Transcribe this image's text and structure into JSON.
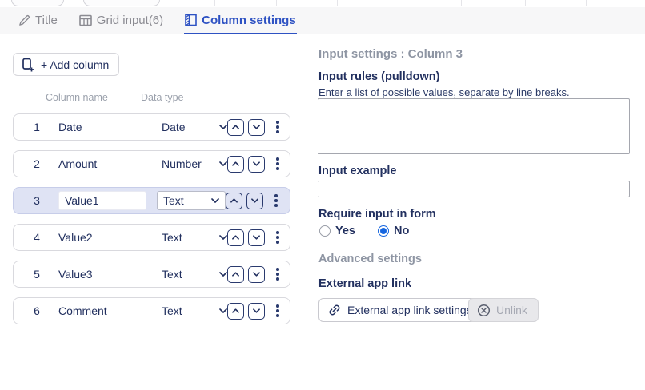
{
  "tabs": [
    {
      "label": "Title",
      "active": false
    },
    {
      "label": "Grid input(6)",
      "active": false
    },
    {
      "label": "Column settings",
      "active": true
    }
  ],
  "left_panel": {
    "add_column_button": "+ Add column",
    "headers": {
      "column_name": "Column name",
      "data_type": "Data type"
    },
    "rows": [
      {
        "num": "1",
        "name": "Date",
        "type": "Date"
      },
      {
        "num": "2",
        "name": "Amount",
        "type": "Number"
      },
      {
        "num": "3",
        "name": "Value1",
        "type": "Text"
      },
      {
        "num": "4",
        "name": "Value2",
        "type": "Text"
      },
      {
        "num": "5",
        "name": "Value3",
        "type": "Text"
      },
      {
        "num": "6",
        "name": "Comment",
        "type": "Text"
      }
    ],
    "selected_row_number": "3"
  },
  "right_panel": {
    "heading": "Input settings : Column 3",
    "input_rules": {
      "label": "Input rules (pulldown)",
      "help": "Enter a list of possible values, separate by line breaks.",
      "value": ""
    },
    "input_example": {
      "label": "Input example",
      "value": ""
    },
    "require_input": {
      "label": "Require input in form",
      "options": [
        {
          "label": "Yes",
          "selected": false
        },
        {
          "label": "No",
          "selected": true
        }
      ]
    },
    "advanced_heading": "Advanced settings",
    "external_app_link": {
      "label": "External app link",
      "settings_button": "External app link settings",
      "unlink_button": "Unlink",
      "unlink_disabled": true
    }
  },
  "icons": {
    "tab_title": "pencil-icon",
    "tab_grid_input": "grid-icon",
    "tab_column_settings": "column-settings-icon",
    "add_column": "add-column-plus-icon",
    "type_dropdown": "chevron-down-icon",
    "move_up": "chevron-up-icon",
    "move_down": "chevron-down-icon",
    "row_menu": "kebab-menu-icon",
    "external_link": "link-icon",
    "unlink": "circle-x-icon"
  },
  "colors": {
    "navy_text": "#22305f",
    "active_tab_blue": "#2e52c3",
    "inactive_tab_gray": "#8b8b92",
    "muted_heading_gray": "#8e95a3",
    "selected_row_bg": "#dfe3f4",
    "radio_selected_blue": "#1565df",
    "row_border": "#d9d9de",
    "tabbar_bg": "#f7f7f8"
  }
}
